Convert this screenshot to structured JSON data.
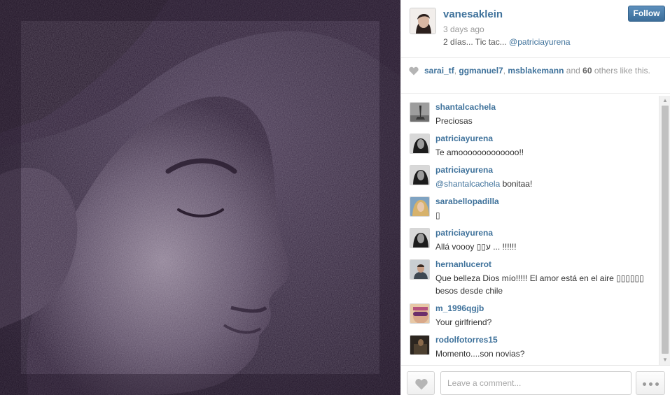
{
  "post": {
    "username": "vanesaklein",
    "time": "3 days ago",
    "caption_text": "2 días... Tic tac... ",
    "caption_mention": "@patriciayurena",
    "follow_label": "Follow"
  },
  "likes": {
    "users": [
      "sarai_tf",
      "ggmanuel7",
      "msblakemann"
    ],
    "sep1": ", ",
    "sep2": ", ",
    "and_text": " and ",
    "count": "60",
    "suffix": " others like this."
  },
  "comments": [
    {
      "user": "shantalcachela",
      "text": "Preciosas",
      "avatar": "gray-figure"
    },
    {
      "user": "patriciayurena",
      "text": "Te amooooooooooooo!!",
      "avatar": "dark-portrait"
    },
    {
      "user": "patriciayurena",
      "mention": "@shantalcachela",
      "text": " bonitaa!",
      "avatar": "dark-portrait"
    },
    {
      "user": "sarabellopadilla",
      "text": "▯",
      "avatar": "blonde-portrait"
    },
    {
      "user": "patriciayurena",
      "text": "Allá voooy ▯▯ע ... !!!!!!",
      "avatar": "dark-portrait"
    },
    {
      "user": "hernanlucerot",
      "text": "Que belleza Dios mío!!!!! El amor está en el aire ▯▯▯▯▯▯ besos desde chile",
      "avatar": "man-portrait"
    },
    {
      "user": "m_1996qgjb",
      "text": "Your girlfriend?",
      "avatar": "sunglasses-portrait"
    },
    {
      "user": "rodolfotorres15",
      "text": "Momento....son novias?",
      "avatar": "man-dark-portrait"
    }
  ],
  "footer": {
    "comment_placeholder": "Leave a comment..."
  },
  "colors": {
    "link": "#3f729b",
    "follow_button": "#4b7eab",
    "photo_tint": "#3a2844"
  }
}
